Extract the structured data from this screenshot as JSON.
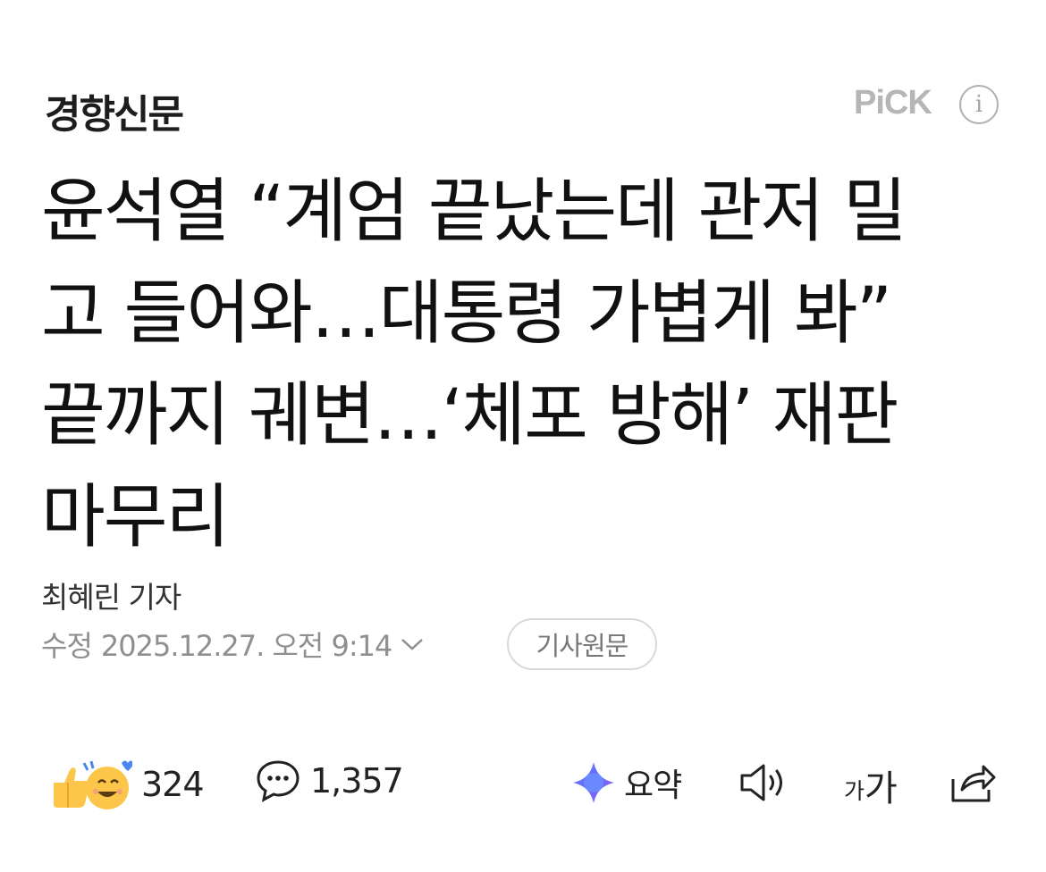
{
  "header": {
    "publisher": "경향신문",
    "pick_label": "PiCK",
    "info_glyph": "i"
  },
  "headline": {
    "lines": [
      "윤석열 “계엄 끝났는데 관저 밀",
      "고 들어와…대통령 가볍게 봐”",
      "끝까지 궤변…‘체포 방해’ 재판",
      "마무리"
    ]
  },
  "byline": {
    "reporter": "최혜린 기자",
    "modified_label": "수정",
    "modified_date": "2025.12.27. 오전 9:14",
    "original_button": "기사원문"
  },
  "actions": {
    "reaction_count": "324",
    "comment_count": "1,357",
    "summary_label": "요약",
    "font_small": "가",
    "font_big": "가"
  },
  "icons": {
    "info": "info-circle-icon",
    "date_toggle": "chevron-down-icon",
    "reaction": "reaction-emoji-icon",
    "comment": "speech-bubble-icon",
    "summary": "ai-sparkle-icon",
    "listen": "speaker-icon",
    "share": "share-icon"
  },
  "colors": {
    "pick": "#b6b6b6",
    "meta_text": "#8f8f8f",
    "text": "#111111",
    "sparkle_blue": "#4f7bff",
    "sparkle_purple": "#8b5cf6"
  }
}
